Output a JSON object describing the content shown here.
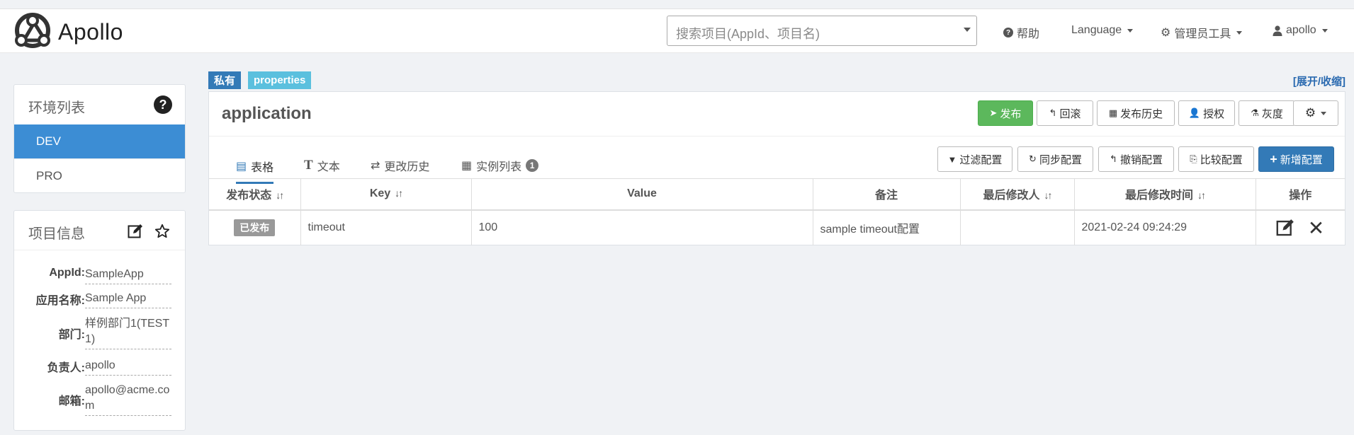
{
  "brand": {
    "name": "Apollo"
  },
  "header": {
    "search_placeholder": "搜索项目(AppId、项目名)",
    "help_label": "帮助",
    "language_label": "Language",
    "admin_tools_label": "管理员工具",
    "user_label": "apollo"
  },
  "env_panel": {
    "title": "环境列表",
    "items": [
      {
        "label": "DEV",
        "active": true
      },
      {
        "label": "PRO",
        "active": false
      }
    ]
  },
  "project_info": {
    "title": "项目信息",
    "fields": [
      {
        "key": "AppId:",
        "value": "SampleApp"
      },
      {
        "key": "应用名称:",
        "value": "Sample App"
      },
      {
        "key": "部门:",
        "value": "样例部门1(TEST1)"
      },
      {
        "key": "负责人:",
        "value": "apollo"
      },
      {
        "key": "邮箱:",
        "value": "apollo@acme.com"
      }
    ]
  },
  "namespace": {
    "tag_private": "私有",
    "tag_format": "properties",
    "expand_label": "[展开/收缩]",
    "name": "application",
    "actions": {
      "publish": "发布",
      "rollback": "回滚",
      "publish_history": "发布历史",
      "authorize": "授权",
      "gray": "灰度"
    },
    "tabs": [
      {
        "label": "表格"
      },
      {
        "label": "文本"
      },
      {
        "label": "更改历史"
      },
      {
        "label": "实例列表",
        "badge": "1"
      }
    ],
    "table_actions": {
      "filter": "过滤配置",
      "sync": "同步配置",
      "revoke": "撤销配置",
      "compare": "比较配置",
      "add": "新增配置"
    },
    "columns": [
      "发布状态",
      "Key",
      "Value",
      "备注",
      "最后修改人",
      "最后修改时间",
      "操作"
    ],
    "rows": [
      {
        "status": "已发布",
        "key": "timeout",
        "value": "100",
        "comment": "sample timeout配置",
        "modifier": "",
        "modified_time": "2021-02-24 09:24:29"
      }
    ]
  },
  "colors": {
    "primary": "#337ab7",
    "active_env": "#3c8dd4",
    "success": "#5cb85c",
    "info": "#5bc0de",
    "page_bg": "#f0f2f5"
  }
}
